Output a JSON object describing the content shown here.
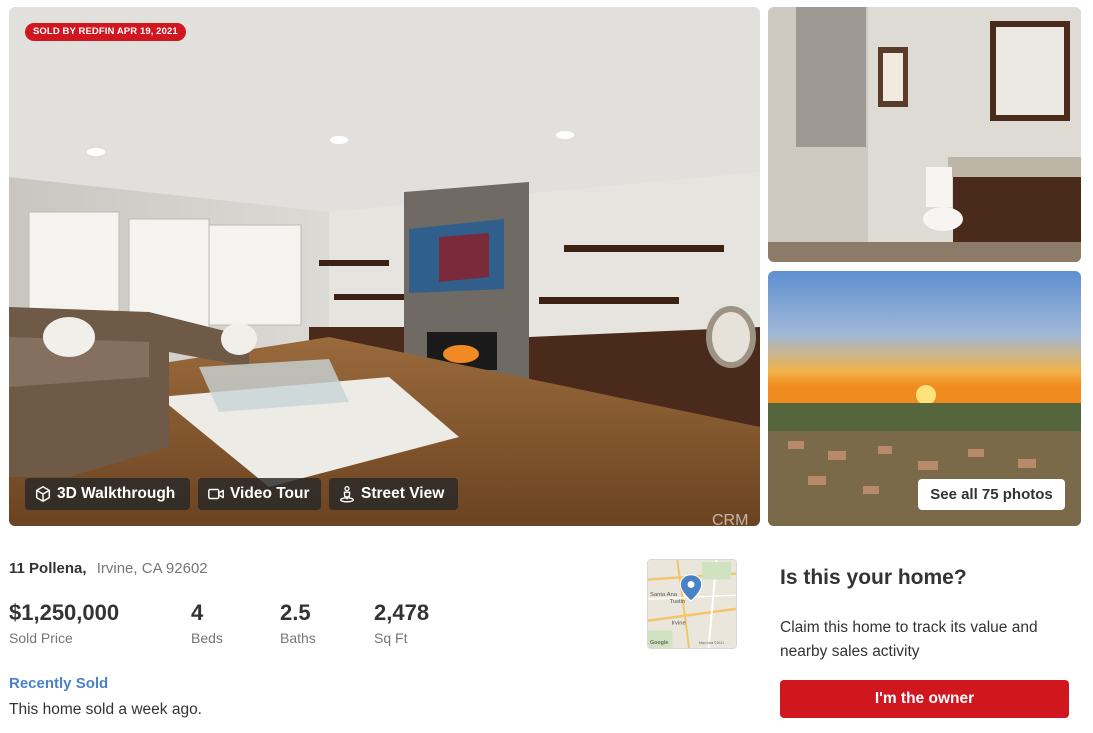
{
  "gallery": {
    "sold_badge": "SOLD BY REDFIN APR 19, 2021",
    "main_photo_watermark": "CRM",
    "buttons": {
      "walkthrough": {
        "label": "3D Walkthrough",
        "icon": "cube-icon"
      },
      "video": {
        "label": "Video Tour",
        "icon": "video-camera-icon"
      },
      "street": {
        "label": "Street View",
        "icon": "pegman-icon"
      }
    },
    "see_all_label": "See all 75 photos"
  },
  "listing": {
    "street": "11 Pollena,",
    "city": "Irvine, CA 92602",
    "stats": [
      {
        "value": "$1,250,000",
        "label": "Sold Price"
      },
      {
        "value": "4",
        "label": "Beds"
      },
      {
        "value": "2.5",
        "label": "Baths"
      },
      {
        "value": "2,478",
        "label": "Sq Ft"
      }
    ],
    "status_title": "Recently Sold",
    "status_desc": "This home sold a week ago."
  },
  "map": {
    "labels": [
      "Santa Ana",
      "Tustin",
      "Irvine",
      "Google",
      "Map data ©2021"
    ],
    "pin_color": "#4a83c5"
  },
  "owner": {
    "title": "Is this your home?",
    "desc": "Claim this home to track its value and nearby sales activity",
    "button_label": "I'm the owner"
  },
  "colors": {
    "brand_red": "#d0161f",
    "link_blue": "#4a83c5",
    "text": "#333333",
    "muted": "#767676"
  }
}
